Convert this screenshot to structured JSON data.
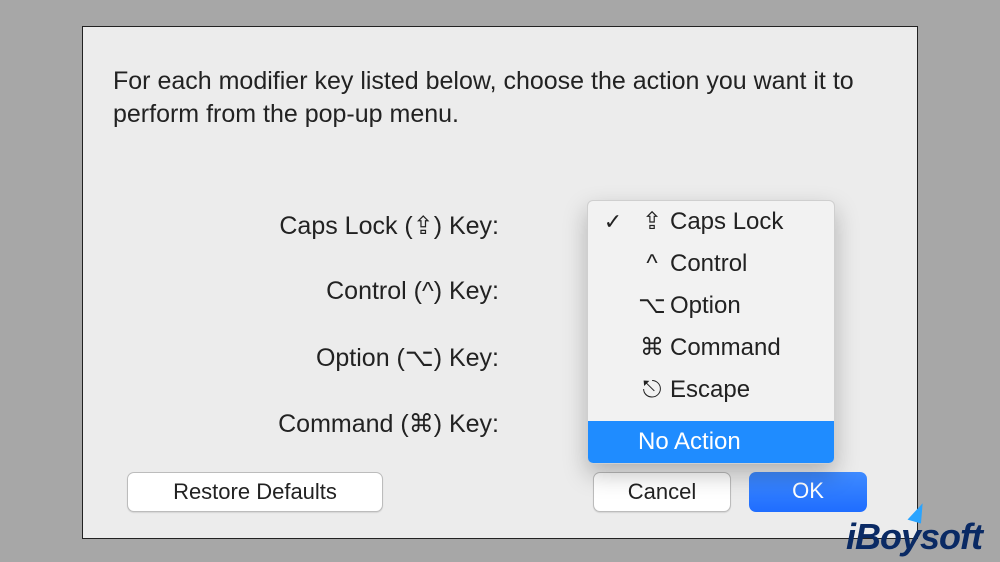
{
  "instruction": "For each modifier key listed below, choose the action you want it to perform from the pop-up menu.",
  "rows": {
    "caps_lock": "Caps Lock (⇪) Key:",
    "control": "Control (^) Key:",
    "option": "Option (⌥) Key:",
    "command": "Command (⌘) Key:"
  },
  "dropdown": {
    "items": [
      {
        "symbol": "⇪",
        "label": "Caps Lock",
        "checked": true
      },
      {
        "symbol": "^",
        "label": "Control",
        "checked": false
      },
      {
        "symbol": "⌥",
        "label": "Option",
        "checked": false
      },
      {
        "symbol": "⌘",
        "label": "Command",
        "checked": false
      },
      {
        "symbol": "⎋",
        "label": "Escape",
        "checked": false
      }
    ],
    "no_action": "No Action",
    "highlighted": "No Action"
  },
  "buttons": {
    "restore": "Restore Defaults",
    "cancel": "Cancel",
    "ok": "OK"
  },
  "watermark": "iBoysoft"
}
